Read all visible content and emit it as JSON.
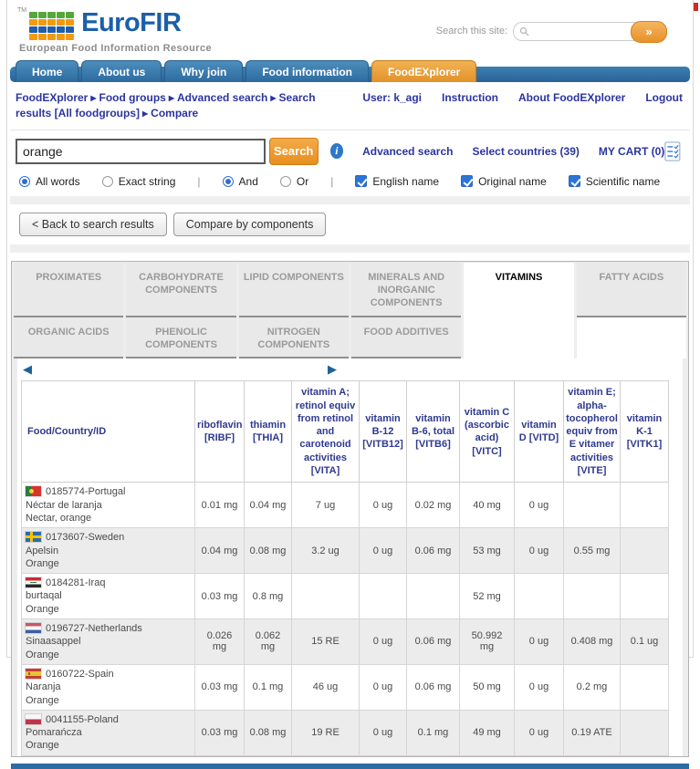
{
  "header": {
    "brand": "EuroFIR",
    "brand_tm": "TM",
    "tagline": "European Food Information Resource",
    "site_search_label": "Search this site:",
    "site_search_value": "",
    "site_search_go": "»"
  },
  "nav": {
    "items": [
      {
        "label": "Home",
        "active": false
      },
      {
        "label": "About us",
        "active": false
      },
      {
        "label": "Why join",
        "active": false
      },
      {
        "label": "Food information",
        "active": false
      },
      {
        "label": "FoodEXplorer",
        "active": true
      }
    ]
  },
  "breadcrumb": {
    "separator": "▶",
    "parts": [
      "FoodEXplorer",
      "Food groups",
      "Advanced search",
      "Search results [All foodgroups]",
      "Compare"
    ]
  },
  "user_bar": {
    "user": "User: k_agi",
    "links": [
      "Instruction",
      "About FoodEXplorer",
      "Logout"
    ]
  },
  "search": {
    "value": "orange",
    "button_label": "Search",
    "info_glyph": "i",
    "links": [
      "Advanced search",
      "Select countries (39)",
      "MY CART (0)"
    ]
  },
  "search_options": {
    "separator": "|",
    "groups": [
      {
        "type": "radio",
        "items": [
          {
            "label": "All words",
            "checked": true
          },
          {
            "label": "Exact string",
            "checked": false
          }
        ]
      },
      {
        "type": "radio",
        "items": [
          {
            "label": "And",
            "checked": true
          },
          {
            "label": "Or",
            "checked": false
          }
        ]
      },
      {
        "type": "checkbox",
        "items": [
          {
            "label": "English name",
            "checked": true
          },
          {
            "label": "Original name",
            "checked": true
          },
          {
            "label": "Scientific name",
            "checked": true
          }
        ]
      }
    ]
  },
  "actions": {
    "back_label": "< Back to search results",
    "compare_label": "Compare by components"
  },
  "component_tabs": {
    "active": "VITAMINS",
    "row1": [
      "PROXIMATES",
      "CARBOHYDRATE COMPONENTS",
      "LIPID COMPONENTS",
      "MINERALS AND INORGANIC COMPONENTS",
      "VITAMINS",
      "FATTY ACIDS"
    ],
    "row2": [
      "ORGANIC ACIDS",
      "PHENOLIC COMPONENTS",
      "NITROGEN COMPONENTS",
      "FOOD ADDITIVES"
    ]
  },
  "table": {
    "scroll_left": "◀",
    "scroll_right": "▶",
    "columns": [
      "Food/Country/ID",
      "riboflavin [RIBF]",
      "thiamin [THIA]",
      "vitamin A; retinol equiv from retinol and carotenoid activities [VITA]",
      "vitamin B-12 [VITB12]",
      "vitamin B-6, total [VITB6]",
      "vitamin C (ascorbic acid) [VITC]",
      "vitamin D [VITD]",
      "vitamin E; alpha-tocopherol equiv from E vitamer activities [VITE]",
      "vitamin K-1 [VITK1]"
    ],
    "rows": [
      {
        "flag": "pt",
        "id": "0185774-Portugal",
        "local_name": "Néctar de laranja",
        "english_name": "Nectar, orange",
        "values": [
          "0.01 mg",
          "0.04 mg",
          "7 ug",
          "0 ug",
          "0.02 mg",
          "40 mg",
          "0 ug",
          "",
          ""
        ]
      },
      {
        "flag": "se",
        "id": "0173607-Sweden",
        "local_name": "Apelsin",
        "english_name": "Orange",
        "values": [
          "0.04 mg",
          "0.08 mg",
          "3.2 ug",
          "0 ug",
          "0.06 mg",
          "53 mg",
          "0 ug",
          "0.55 mg",
          ""
        ]
      },
      {
        "flag": "iq",
        "id": "0184281-Iraq",
        "local_name": "burtaqal",
        "english_name": "Orange",
        "values": [
          "0.03 mg",
          "0.8 mg",
          "",
          "",
          "",
          "52 mg",
          "",
          "",
          ""
        ]
      },
      {
        "flag": "nl",
        "id": "0196727-Netherlands",
        "local_name": "Sinaasappel",
        "english_name": "Orange",
        "values": [
          "0.026 mg",
          "0.062 mg",
          "15 RE",
          "0 ug",
          "0.06 mg",
          "50.992 mg",
          "0 ug",
          "0.408 mg",
          "0.1 ug"
        ]
      },
      {
        "flag": "es",
        "id": "0160722-Spain",
        "local_name": "Naranja",
        "english_name": "Orange",
        "values": [
          "0.03 mg",
          "0.1 mg",
          "46 ug",
          "0 ug",
          "0.06 mg",
          "50 mg",
          "0 ug",
          "0.2 mg",
          ""
        ]
      },
      {
        "flag": "pl",
        "id": "0041155-Poland",
        "local_name": "Pomarańcza",
        "english_name": "Orange",
        "values": [
          "0.03 mg",
          "0.08 mg",
          "19 RE",
          "0 ug",
          "0.1 mg",
          "49 mg",
          "0 ug",
          "0.19 ATE",
          ""
        ]
      }
    ]
  },
  "colors": {
    "nav_blue": "#336f9f",
    "accent_orange": "#e8912a",
    "link_navy": "#2b35a0",
    "table_header_navy": "#2f3a8f",
    "inactive_tab_text": "#9a9a9a",
    "footer_blue": "#2d6ca2",
    "badge_red": "#d42a22"
  }
}
